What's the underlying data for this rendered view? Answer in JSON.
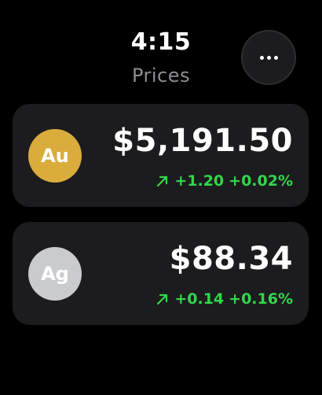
{
  "header": {
    "time": "4:15",
    "title": "Prices"
  },
  "more_button": {
    "icon": "ellipsis-icon"
  },
  "metals": [
    {
      "symbol": "Au",
      "price": "$5,191.50",
      "change_amount": "+1.20",
      "change_percent": "+0.02%",
      "trend": "up",
      "badge_color": "#d9ac3c"
    },
    {
      "symbol": "Ag",
      "price": "$88.34",
      "change_amount": "+0.14",
      "change_percent": "+0.16%",
      "trend": "up",
      "badge_color": "#c9cbcf"
    }
  ],
  "colors": {
    "background": "#000000",
    "card": "#1c1c1e",
    "positive": "#32d74b",
    "subtitle": "#8e8e93"
  }
}
